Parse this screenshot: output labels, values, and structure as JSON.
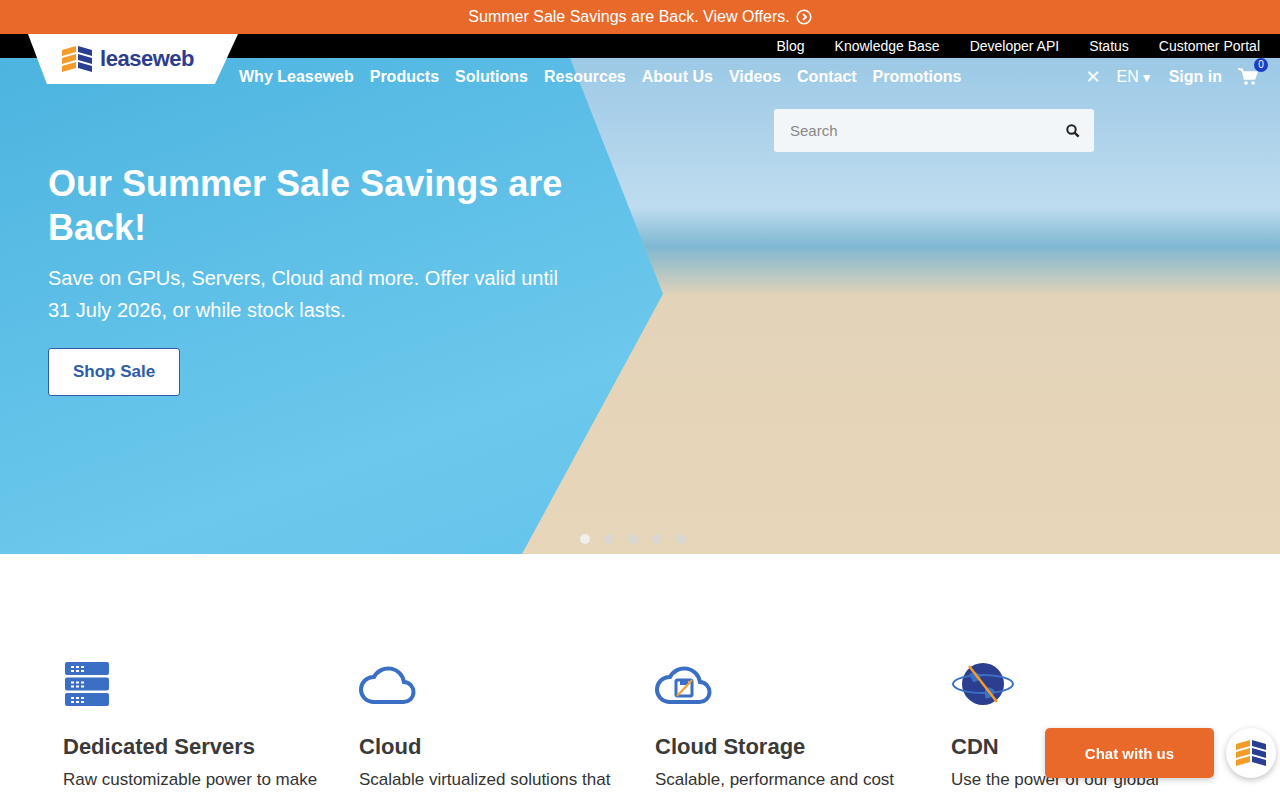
{
  "promo_bar": {
    "text": "Summer Sale Savings are Back. View Offers."
  },
  "top_links": [
    "Blog",
    "Knowledge Base",
    "Developer API",
    "Status",
    "Customer Portal"
  ],
  "logo": {
    "text": "leaseweb"
  },
  "nav": {
    "items": [
      "Why Leaseweb",
      "Products",
      "Solutions",
      "Resources",
      "About Us",
      "Videos",
      "Contact",
      "Promotions"
    ],
    "close": "✕",
    "language": "EN",
    "language_arrow": "▼",
    "sign_in": "Sign in",
    "cart_count": "0"
  },
  "search": {
    "placeholder": "Search"
  },
  "hero": {
    "title": "Our Summer Sale Savings are Back!",
    "subtitle": "Save on GPUs, Servers, Cloud and more. Offer valid until 31 July 2026, or while stock lasts.",
    "button": "Shop Sale",
    "slides": [
      {
        "selected": true
      },
      {
        "selected": false
      },
      {
        "selected": false
      },
      {
        "selected": false
      },
      {
        "selected": false
      }
    ]
  },
  "products": [
    {
      "kind": "servers",
      "title": "Dedicated Servers",
      "description": "Raw customizable power to make"
    },
    {
      "kind": "cloud",
      "title": "Cloud",
      "description": "Scalable virtualized solutions that"
    },
    {
      "kind": "storage",
      "title": "Cloud Storage",
      "description": "Scalable, performance and cost"
    },
    {
      "kind": "globe",
      "title": "CDN",
      "description": "Use the power of our global"
    }
  ],
  "chat": {
    "label": "Chat with us"
  }
}
